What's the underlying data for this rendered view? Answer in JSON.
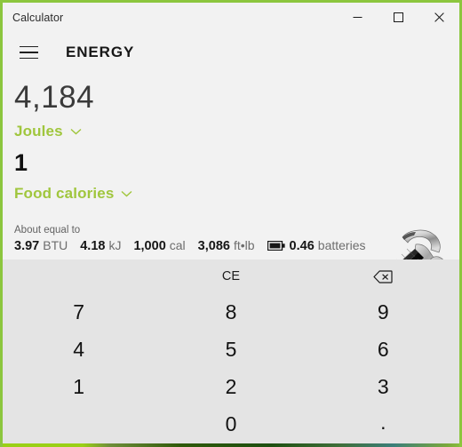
{
  "window": {
    "title": "Calculator",
    "accent_color": "#8cc63e",
    "display_bg": "#f2f2f2",
    "keypad_bg": "#e4e4e4"
  },
  "titlebar": {
    "minimize_label": "Minimize",
    "maximize_label": "Maximize",
    "close_label": "Close"
  },
  "header": {
    "menu_label": "Open Navigation",
    "mode_title": "ENERGY"
  },
  "display": {
    "from": {
      "value": "4,184",
      "unit": "Joules"
    },
    "to": {
      "value": "1",
      "unit": "Food calories"
    },
    "illustration": "hammer-icon"
  },
  "about": {
    "caption": "About equal to",
    "items": [
      {
        "icon": "",
        "value": "3.97",
        "unit": "BTU"
      },
      {
        "icon": "",
        "value": "4.18",
        "unit": "kJ"
      },
      {
        "icon": "",
        "value": "1,000",
        "unit": "cal"
      },
      {
        "icon": "",
        "value": "3,086",
        "unit": "ft•lb"
      },
      {
        "icon": "battery-icon",
        "value": "0.46",
        "unit": "batteries"
      }
    ]
  },
  "keypad": {
    "clear_entry": "CE",
    "backspace": "backspace-icon",
    "keys": [
      "7",
      "8",
      "9",
      "4",
      "5",
      "6",
      "1",
      "2",
      "3",
      "",
      "0",
      "."
    ]
  }
}
